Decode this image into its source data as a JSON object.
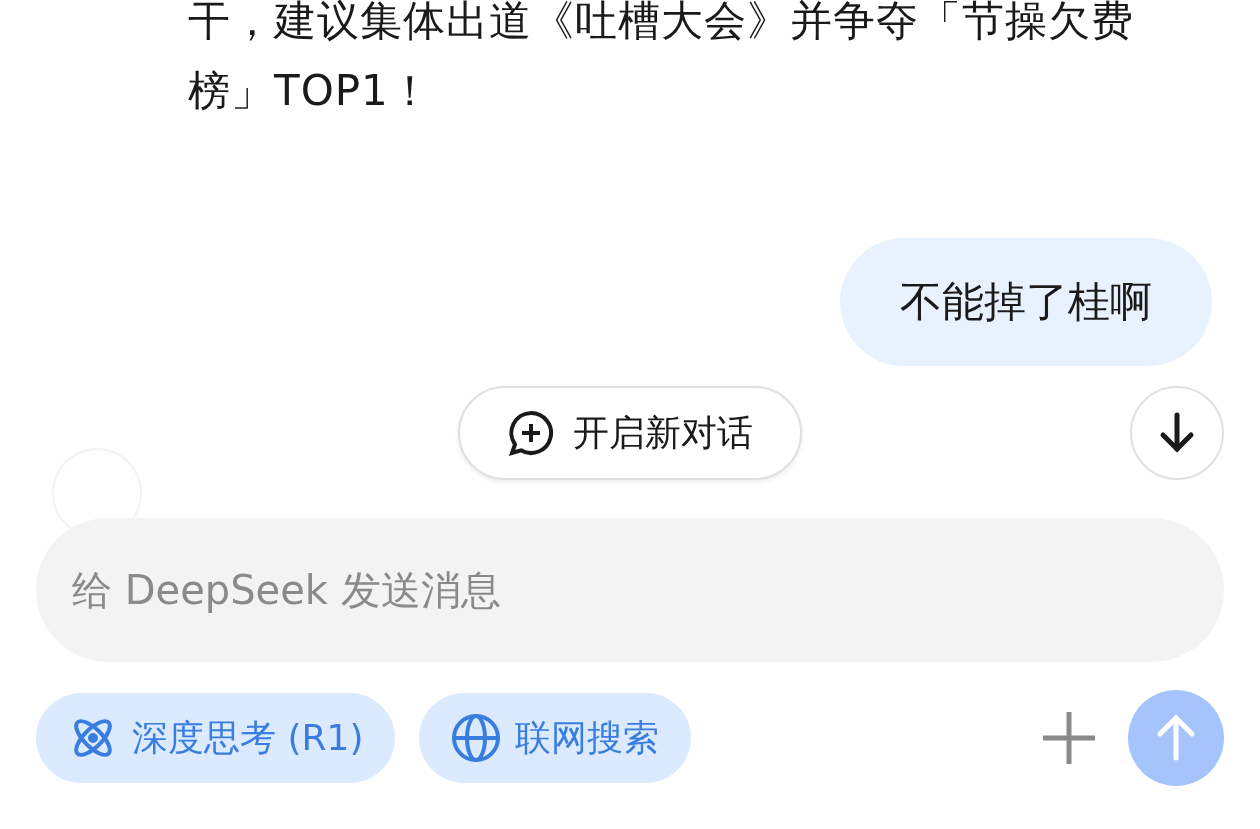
{
  "reply": {
    "text": "干，建议集体出道《吐槽大会》并争夺「节操欠费榜」TOP1！"
  },
  "user_message": {
    "text": "不能掉了桂啊"
  },
  "new_chat_button": {
    "label": "开启新对话"
  },
  "composer": {
    "placeholder": "给 DeepSeek 发送消息"
  },
  "toggles": [
    {
      "kind": "think",
      "label": "深度思考 (R1)",
      "selected": true
    },
    {
      "kind": "search",
      "label": "联网搜索",
      "selected": true
    }
  ],
  "send_button": {
    "disabled": true
  }
}
